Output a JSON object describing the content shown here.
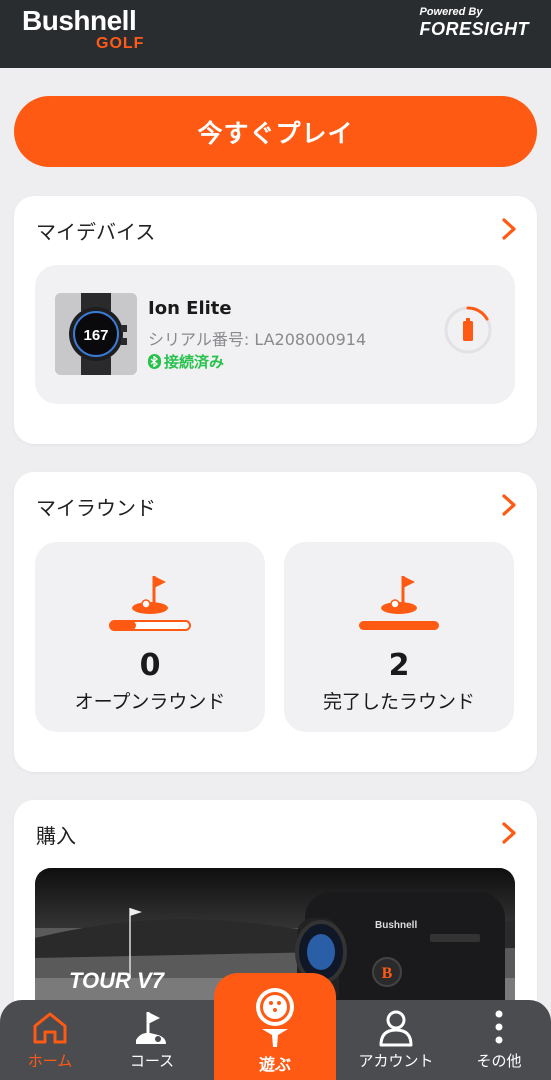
{
  "header": {
    "brand_name": "Bushnell",
    "brand_sub": "GOLF",
    "powered_by": "Powered By",
    "partner_logo": "FORESIGHT"
  },
  "play_button": {
    "label": "今すぐプレイ"
  },
  "my_devices": {
    "title": "マイデバイス",
    "device": {
      "name": "Ion Elite",
      "serial": "シリアル番号: LA208000914",
      "status": "接続済み",
      "watch_face_number": "167",
      "battery_icon": "battery-low-icon"
    }
  },
  "my_rounds": {
    "title": "マイラウンド",
    "open_rounds": {
      "count": "0",
      "label": "オープンラウンド"
    },
    "completed_rounds": {
      "count": "2",
      "label": "完了したラウンド"
    }
  },
  "purchase": {
    "title": "購入",
    "promo": {
      "product_text": "TOUR V7",
      "device_brand": "Bushnell"
    }
  },
  "tabbar": {
    "home": "ホーム",
    "course": "コース",
    "play": "遊ぶ",
    "account": "アカウント",
    "more": "その他"
  },
  "colors": {
    "accent": "#ff5a14",
    "connected": "#27c24c",
    "header_bg": "#2a2d30",
    "tabbar_bg": "#4a4c50"
  }
}
